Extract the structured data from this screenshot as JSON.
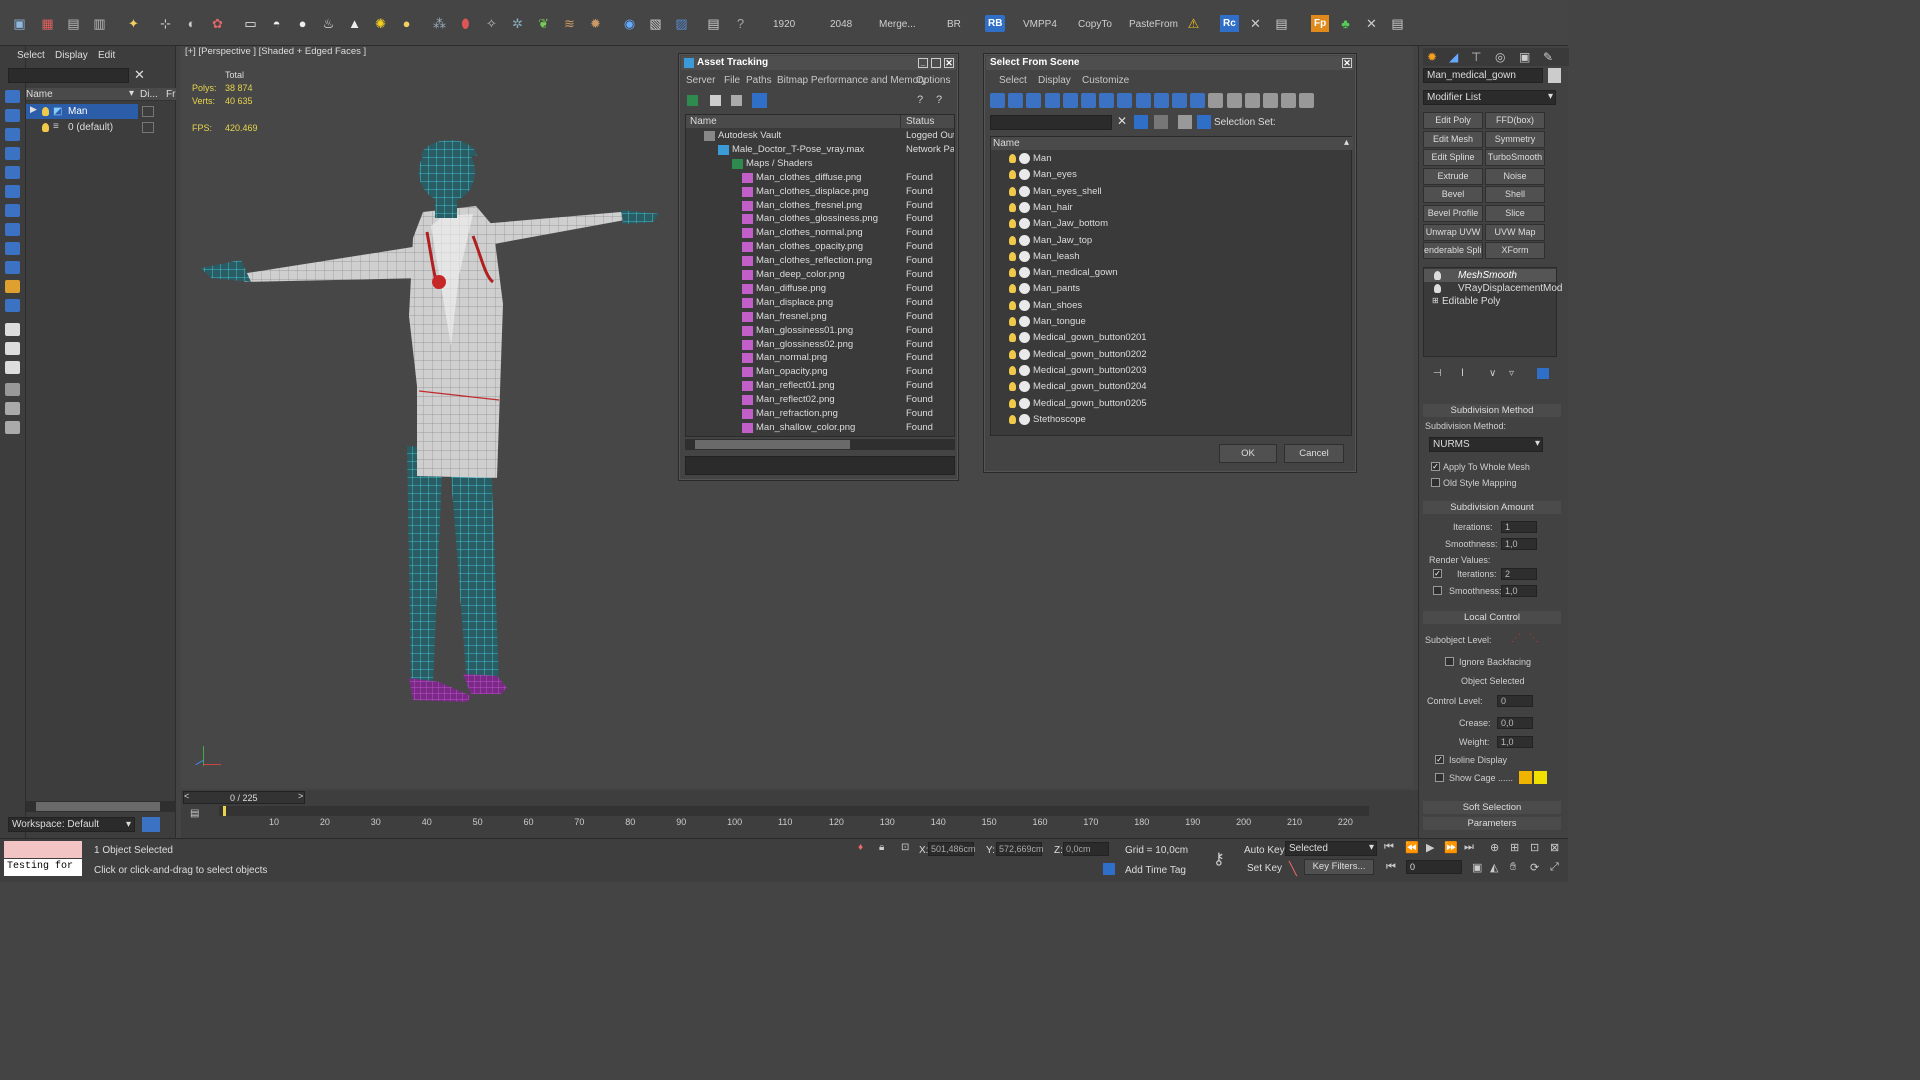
{
  "toolbar": {
    "numbers": [
      "1920",
      "2048"
    ],
    "labels": [
      "Merge...",
      "BR",
      "RB",
      "VMPP4",
      "CopyTo",
      "PasteFrom",
      "Rc",
      "Fp"
    ]
  },
  "scene_explorer": {
    "menu": [
      "Select",
      "Display",
      "Edit"
    ],
    "col_name": "Name",
    "col_display": "Di...",
    "col_freeze": "Fr",
    "rows": [
      {
        "label": "Man",
        "selected": true
      },
      {
        "label": "0 (default)",
        "selected": false
      }
    ],
    "workspace": "Workspace: Default"
  },
  "viewport": {
    "label": "[+] [Perspective ] [Shaded + Edged Faces ]",
    "stats": {
      "total_label": "Total",
      "polys_label": "Polys:",
      "polys": "38 874",
      "verts_label": "Verts:",
      "verts": "40 635",
      "fps_label": "FPS:",
      "fps": "420.469"
    }
  },
  "asset_tracking": {
    "title": "Asset Tracking",
    "menu": [
      "Server",
      "File",
      "Paths",
      "Bitmap Performance and Memory",
      "Options"
    ],
    "col_name": "Name",
    "col_status": "Status",
    "rows": [
      {
        "name": "Autodesk Vault",
        "status": "Logged Out",
        "indent": 0
      },
      {
        "name": "Male_Doctor_T-Pose_vray.max",
        "status": "Network Pa",
        "indent": 1
      },
      {
        "name": "Maps / Shaders",
        "status": "",
        "indent": 2
      },
      {
        "name": "Man_clothes_diffuse.png",
        "status": "Found",
        "indent": 3
      },
      {
        "name": "Man_clothes_displace.png",
        "status": "Found",
        "indent": 3
      },
      {
        "name": "Man_clothes_fresnel.png",
        "status": "Found",
        "indent": 3
      },
      {
        "name": "Man_clothes_glossiness.png",
        "status": "Found",
        "indent": 3
      },
      {
        "name": "Man_clothes_normal.png",
        "status": "Found",
        "indent": 3
      },
      {
        "name": "Man_clothes_opacity.png",
        "status": "Found",
        "indent": 3
      },
      {
        "name": "Man_clothes_reflection.png",
        "status": "Found",
        "indent": 3
      },
      {
        "name": "Man_deep_color.png",
        "status": "Found",
        "indent": 3
      },
      {
        "name": "Man_diffuse.png",
        "status": "Found",
        "indent": 3
      },
      {
        "name": "Man_displace.png",
        "status": "Found",
        "indent": 3
      },
      {
        "name": "Man_fresnel.png",
        "status": "Found",
        "indent": 3
      },
      {
        "name": "Man_glossiness01.png",
        "status": "Found",
        "indent": 3
      },
      {
        "name": "Man_glossiness02.png",
        "status": "Found",
        "indent": 3
      },
      {
        "name": "Man_normal.png",
        "status": "Found",
        "indent": 3
      },
      {
        "name": "Man_opacity.png",
        "status": "Found",
        "indent": 3
      },
      {
        "name": "Man_reflect01.png",
        "status": "Found",
        "indent": 3
      },
      {
        "name": "Man_reflect02.png",
        "status": "Found",
        "indent": 3
      },
      {
        "name": "Man_refraction.png",
        "status": "Found",
        "indent": 3
      },
      {
        "name": "Man_shallow_color.png",
        "status": "Found",
        "indent": 3
      }
    ]
  },
  "select_from_scene": {
    "title": "Select From Scene",
    "menu": [
      "Select",
      "Display",
      "Customize"
    ],
    "selection_set_label": "Selection Set:",
    "col_name": "Name",
    "items": [
      "Man",
      "Man_eyes",
      "Man_eyes_shell",
      "Man_hair",
      "Man_Jaw_bottom",
      "Man_Jaw_top",
      "Man_leash",
      "Man_medical_gown",
      "Man_pants",
      "Man_shoes",
      "Man_tongue",
      "Medical_gown_button0201",
      "Medical_gown_button0202",
      "Medical_gown_button0203",
      "Medical_gown_button0204",
      "Medical_gown_button0205",
      "Stethoscope"
    ],
    "ok": "OK",
    "cancel": "Cancel"
  },
  "command_panel": {
    "object_name": "Man_medical_gown",
    "modifier_list": "Modifier List",
    "buttons": [
      [
        "Edit Poly",
        "FFD(box)"
      ],
      [
        "Edit Mesh",
        "Symmetry"
      ],
      [
        "Edit Spline",
        "TurboSmooth"
      ],
      [
        "Extrude",
        "Noise"
      ],
      [
        "Bevel",
        "Shell"
      ],
      [
        "Bevel Profile",
        "Slice"
      ],
      [
        "Unwrap UVW",
        "UVW Map"
      ],
      [
        "enderable Splir",
        "XForm"
      ]
    ],
    "stack": [
      "MeshSmooth",
      "VRayDisplacementMod",
      "Editable Poly"
    ],
    "subdivision_method": {
      "title": "Subdivision Method",
      "label": "Subdivision Method:",
      "value": "NURMS",
      "apply_whole": "Apply To Whole Mesh",
      "apply_whole_checked": true,
      "old_style": "Old Style Mapping",
      "old_style_checked": false
    },
    "subdivision_amount": {
      "title": "Subdivision Amount",
      "iterations_label": "Iterations:",
      "iterations": "1",
      "smoothness_label": "Smoothness:",
      "smoothness": "1,0",
      "render_values": "Render Values:",
      "render_iterations": "2",
      "render_smoothness": "1,0"
    },
    "local_control": {
      "title": "Local Control",
      "subobject_label": "Subobject Level:",
      "ignore_backfacing": "Ignore Backfacing",
      "object_selected": "Object Selected",
      "control_level_label": "Control Level:",
      "control_level": "0",
      "crease_label": "Crease:",
      "crease": "0,0",
      "weight_label": "Weight:",
      "weight": "1,0",
      "isoline": "Isoline Display",
      "show_cage": "Show Cage ......"
    },
    "soft_selection": "Soft Selection",
    "parameters": "Parameters"
  },
  "timeline": {
    "frame": "0 / 225",
    "ticks": [
      "10",
      "20",
      "30",
      "40",
      "50",
      "60",
      "70",
      "80",
      "90",
      "100",
      "110",
      "120",
      "130",
      "140",
      "150",
      "160",
      "170",
      "180",
      "190",
      "200",
      "210",
      "220"
    ]
  },
  "status": {
    "script_text": "Testing for",
    "selected": "1 Object Selected",
    "prompt": "Click or click-and-drag to select objects",
    "x_label": "X:",
    "x": "501,486cm",
    "y_label": "Y:",
    "y": "572,669cm",
    "z_label": "Z:",
    "z": "0,0cm",
    "grid": "Grid = 10,0cm",
    "add_time_tag": "Add Time Tag",
    "auto_key": "Auto Key",
    "set_key": "Set Key",
    "key_mode": "Selected",
    "key_filters": "Key Filters...",
    "frame_field": "0"
  },
  "colors": {
    "wire_cyan": "#3fd3e6",
    "wire_white": "#f2f2f2",
    "shoe_magenta": "#b43cc8",
    "stat_yellow": "#e8d44d",
    "select_blue": "#2c5da8"
  }
}
